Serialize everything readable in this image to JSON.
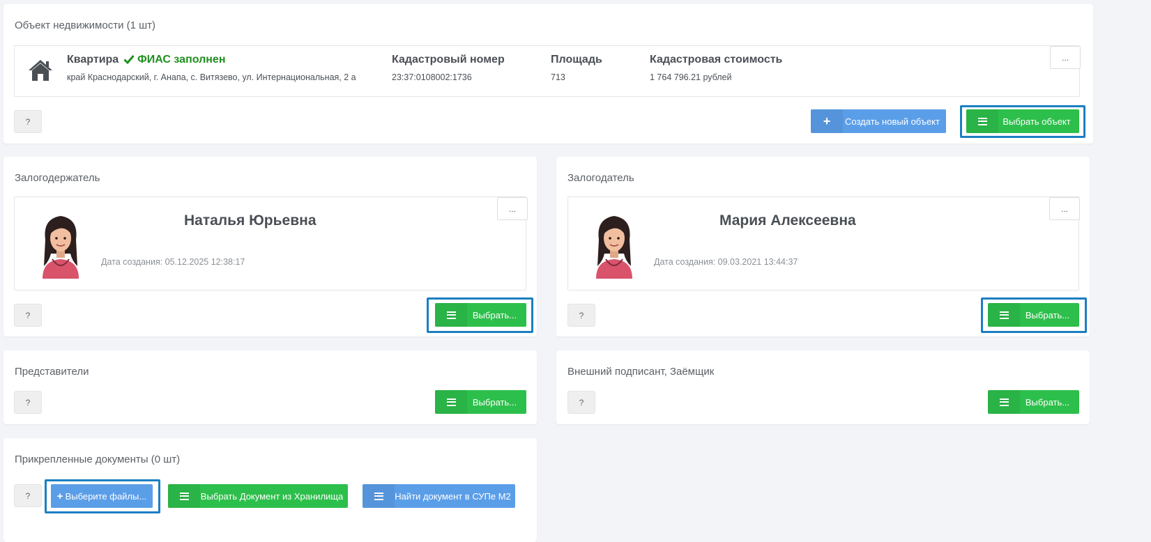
{
  "property": {
    "title": "Объект недвижимости (1 шт)",
    "type": "Квартира",
    "fias_status": "ФИАС заполнен",
    "address": "край Краснодарский, г. Анапа, с. Витязево, ул. Интернациональная, 2 а",
    "cadastral_number_label": "Кадастровый номер",
    "cadastral_number": "23:37:0108002:1736",
    "area_label": "Площадь",
    "area": "713",
    "cadastral_value_label": "Кадастровая стоимость",
    "cadastral_value": "1 764 796.21 рублей",
    "more_label": "...",
    "help_label": "?",
    "create_label": "Создать новый объект",
    "select_label": "Выбрать объект"
  },
  "pledgee": {
    "title": "Залогодержатель",
    "name": "Наталья Юрьевна",
    "date": "Дата создания: 05.12.2025 12:38:17",
    "more_label": "...",
    "help_label": "?",
    "select_label": "Выбрать..."
  },
  "pledgor": {
    "title": "Залогодатель",
    "name": "Мария Алексеевна",
    "date": "Дата создания: 09.03.2021 13:44:37",
    "more_label": "...",
    "help_label": "?",
    "select_label": "Выбрать..."
  },
  "representatives": {
    "title": "Представители",
    "help_label": "?",
    "select_label": "Выбрать..."
  },
  "external_signer": {
    "title": "Внешний подписант, Заёмщик",
    "help_label": "?",
    "select_label": "Выбрать..."
  },
  "documents": {
    "title": "Прикрепленные документы (0 шт)",
    "help_label": "?",
    "choose_files_label": "Выберите файлы...",
    "storage_label": "Выбрать Документ из Хранилища",
    "find_label": "Найти документ в СУПе М2"
  },
  "colors": {
    "green": "#2dbf4b",
    "blue": "#5b9ee8",
    "fias_green": "#1f8f1f",
    "focus": "#1b7fc1"
  }
}
